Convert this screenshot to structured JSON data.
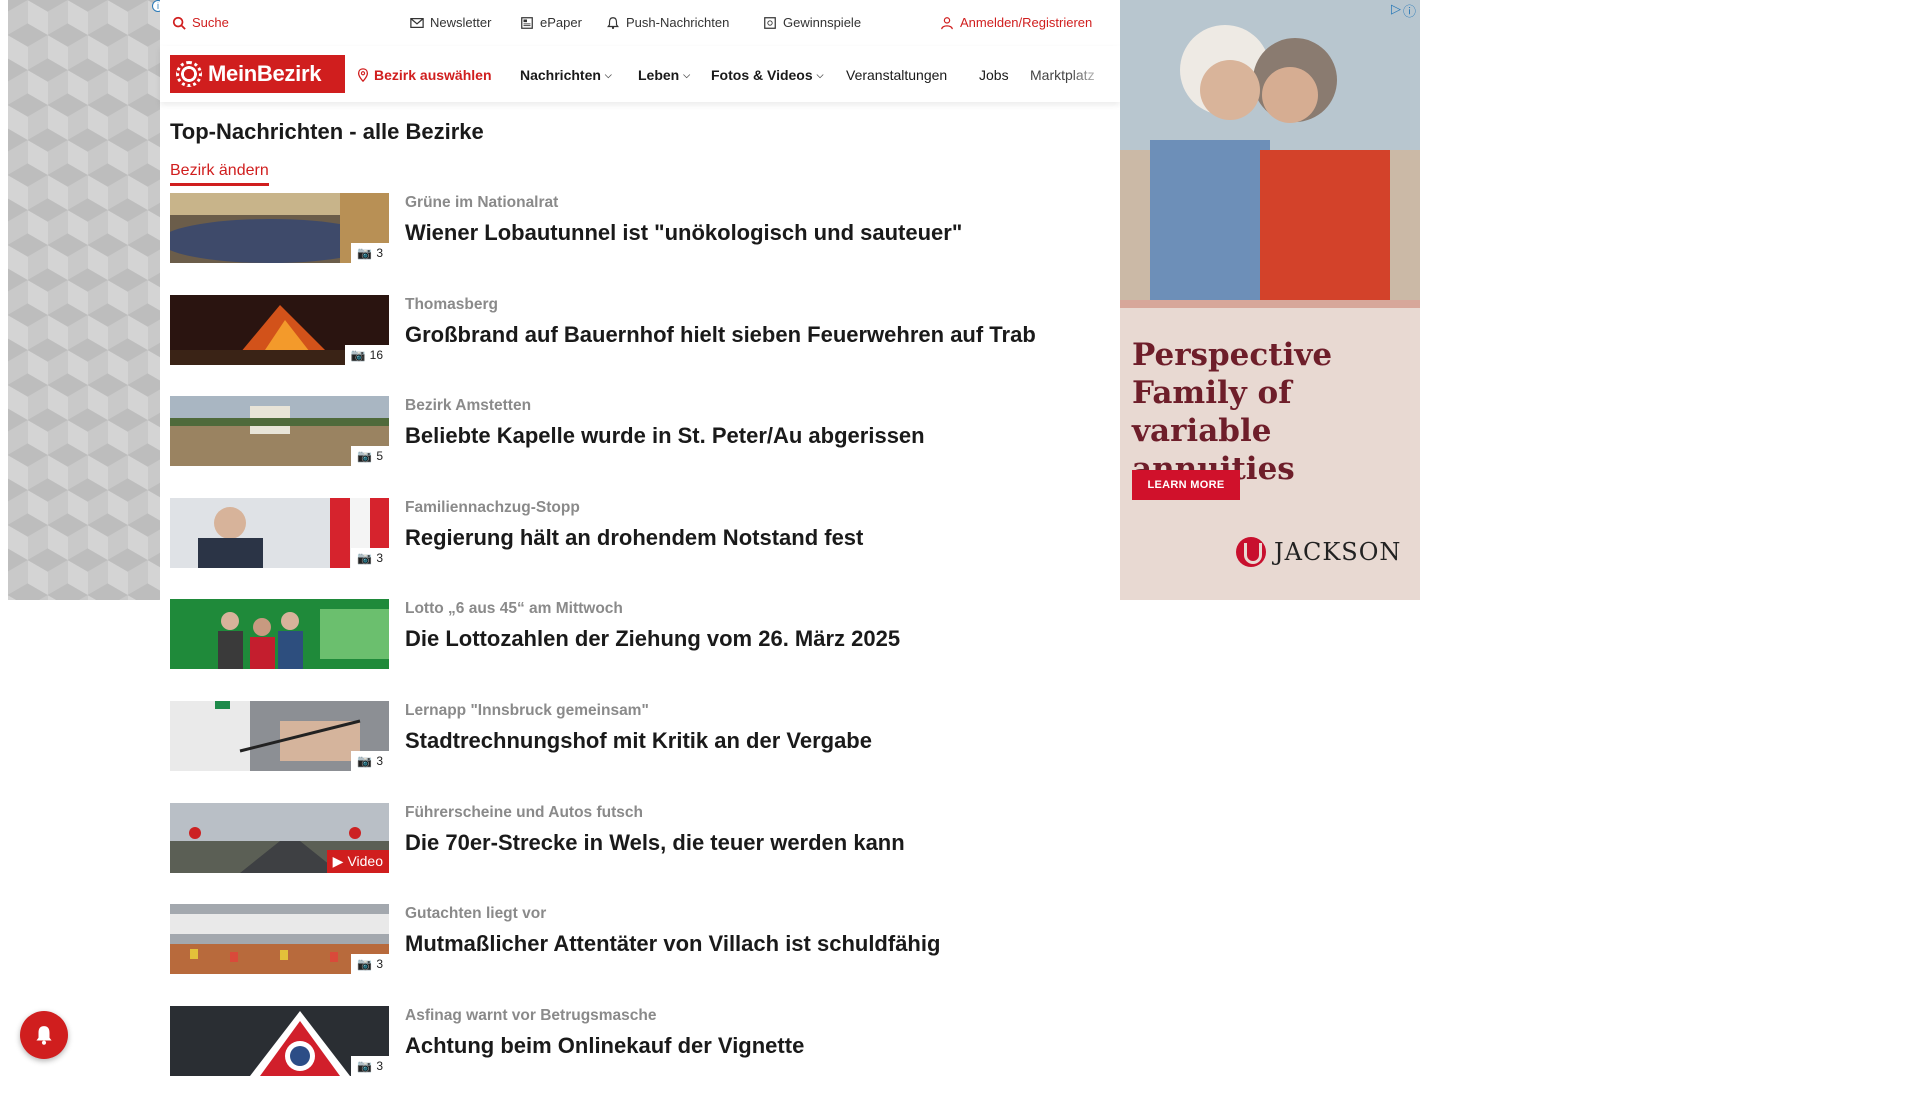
{
  "topbar": {
    "search": "Suche",
    "newsletter": "Newsletter",
    "epaper": "ePaper",
    "push": "Push-Nachrichten",
    "gewinnspiele": "Gewinnspiele",
    "login": "Anmelden/Registrieren"
  },
  "nav": {
    "logo": "MeinBezirk",
    "bezirk": "Bezirk auswählen",
    "items": [
      "Nachrichten",
      "Leben",
      "Fotos & Videos",
      "Veranstaltungen",
      "Jobs",
      "Marktplatz"
    ]
  },
  "section": {
    "title": "Top-Nachrichten - alle Bezirke",
    "change": "Bezirk ändern"
  },
  "articles": [
    {
      "kicker": "Grüne im Nationalrat",
      "headline": "Wiener Lobautunnel ist \"unökologisch und sauteuer\"",
      "badge": "3"
    },
    {
      "kicker": "Thomasberg",
      "headline": "Großbrand auf Bauernhof hielt sieben Feuerwehren auf Trab",
      "badge": "16"
    },
    {
      "kicker": "Bezirk Amstetten",
      "headline": "Beliebte Kapelle wurde in St. Peter/Au abgerissen",
      "badge": "5"
    },
    {
      "kicker": "Familiennachzug-Stopp",
      "headline": "Regierung hält an drohendem Notstand fest",
      "badge": "3"
    },
    {
      "kicker": "Lotto „6 aus 45“ am Mittwoch",
      "headline": "Die Lottozahlen der Ziehung vom 26. März 2025",
      "badge": ""
    },
    {
      "kicker": "Lernapp \"Innsbruck gemeinsam\"",
      "headline": "Stadtrechnungshof mit Kritik an der Vergabe",
      "badge": "3"
    },
    {
      "kicker": "Führerscheine und Autos futsch",
      "headline": "Die 70er-Strecke in Wels, die teuer werden kann",
      "badge": "Video"
    },
    {
      "kicker": "Gutachten liegt vor",
      "headline": "Mutmaßlicher Attentäter von Villach ist schuldfähig",
      "badge": "3"
    },
    {
      "kicker": "Asfinag warnt vor Betrugsmasche",
      "headline": "Achtung beim Onlinekauf der Vignette",
      "badge": "3"
    }
  ],
  "ad": {
    "headline": "Perspective Family of variable annuities",
    "cta": "LEARN MORE",
    "brand": "JACKSON",
    "brand_color": "#c8102e"
  },
  "colors": {
    "accent": "#d01e1e",
    "kicker": "#8a8a8a"
  }
}
